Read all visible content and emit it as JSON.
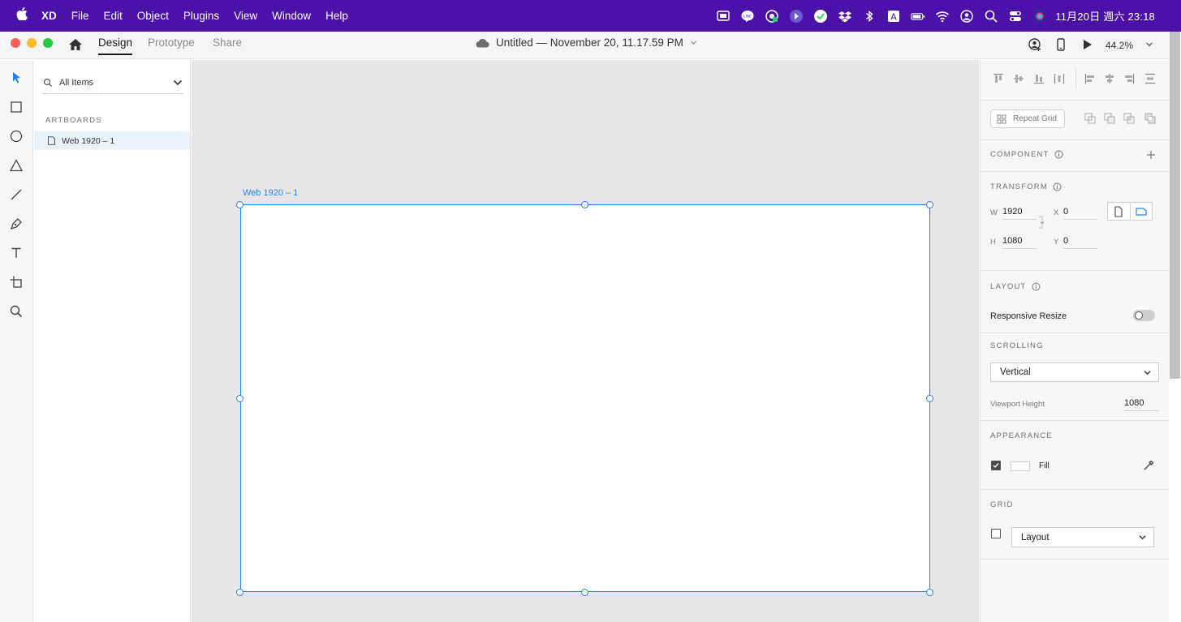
{
  "menubar": {
    "app_name": "XD",
    "items": [
      "File",
      "Edit",
      "Object",
      "Plugins",
      "View",
      "Window",
      "Help"
    ],
    "clock": "11月20日 週六  23:18",
    "bg_color": "#4a12a8"
  },
  "titlebar": {
    "tabs": [
      "Design",
      "Prototype",
      "Share"
    ],
    "active_tab": "Design",
    "doc_title": "Untitled — November 20, 11.17.59 PM",
    "zoom": "44.2%"
  },
  "layers": {
    "search_label": "All Items",
    "section": "ARTBOARDS",
    "items": [
      "Web 1920 – 1"
    ]
  },
  "canvas": {
    "artboard_name": "Web 1920 – 1",
    "accent": "#2680eb"
  },
  "inspector": {
    "repeat_grid": "Repeat Grid",
    "component_label": "COMPONENT",
    "transform_label": "TRANSFORM",
    "w_label": "W",
    "w_value": "1920",
    "h_label": "H",
    "h_value": "1080",
    "x_label": "X",
    "x_value": "0",
    "y_label": "Y",
    "y_value": "0",
    "layout_label": "LAYOUT",
    "responsive_resize": "Responsive Resize",
    "scrolling_label": "SCROLLING",
    "scrolling_value": "Vertical",
    "viewport_label": "Viewport Height",
    "viewport_value": "1080",
    "appearance_label": "APPEARANCE",
    "fill_label": "Fill",
    "grid_label": "GRID",
    "grid_value": "Layout"
  }
}
